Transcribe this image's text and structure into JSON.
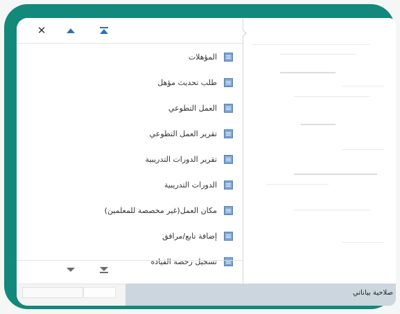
{
  "popup": {
    "header": {
      "close_icon": "close-icon",
      "scroll_up_icon": "triangle-up-icon",
      "scroll_top_icon": "triangle-up-bar-icon"
    },
    "items": [
      {
        "label": "المؤهلات",
        "icon": "document-icon"
      },
      {
        "label": "طلب تحديث مؤهل",
        "icon": "document-icon"
      },
      {
        "label": "العمل التطوعي",
        "icon": "document-icon"
      },
      {
        "label": "تقرير العمل التطوعي",
        "icon": "document-icon"
      },
      {
        "label": "تقرير الدورات التدريبية",
        "icon": "document-icon"
      },
      {
        "label": "الدورات التدريبية",
        "icon": "document-icon"
      },
      {
        "label": "مكان العمل(غير مخصصة للمعلمين)",
        "icon": "document-icon"
      },
      {
        "label": "إضافة تابع/مرافق",
        "icon": "document-icon"
      },
      {
        "label": "تسجيل رخصة القيادة",
        "icon": "document-icon"
      }
    ],
    "footer": {
      "scroll_down_icon": "triangle-down-icon",
      "scroll_bottom_icon": "triangle-down-bar-icon"
    }
  },
  "page": {
    "footer_label": "صلاحية بياناتي"
  },
  "colors": {
    "frame": "#12897a",
    "accent": "#2e70b7",
    "footer_bar": "#cbd6de"
  }
}
